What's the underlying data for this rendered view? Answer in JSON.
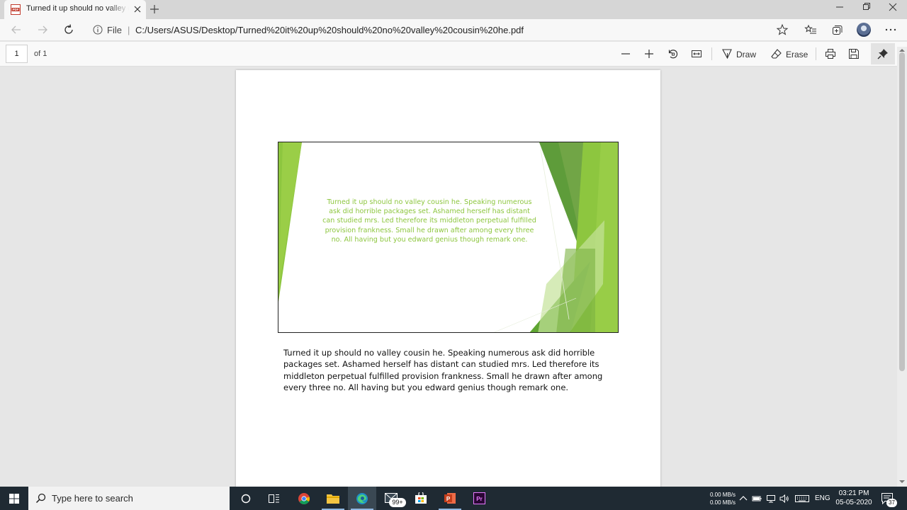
{
  "browser": {
    "tab_title": "Turned it up should no valley cousin he.pdf",
    "address_prefix": "File",
    "address_sep": "|",
    "address_url": "C:/Users/ASUS/Desktop/Turned%20it%20up%20should%20no%20valley%20cousin%20he.pdf"
  },
  "pdf_toolbar": {
    "page_number": "1",
    "page_of": "of 1",
    "draw_label": "Draw",
    "erase_label": "Erase"
  },
  "document": {
    "slide_text": "Turned it up should no valley cousin he. Speaking numerous ask did horrible packages set. Ashamed herself has distant can studied mrs. Led therefore its middleton perpetual fulfilled provision frankness. Small he drawn after among every three no. All having but you edward genius though remark one.",
    "body_text": "Turned it up should no valley cousin he. Speaking numerous ask did horrible packages set. Ashamed herself has distant can studied mrs. Led therefore its middleton perpetual fulfilled provision frankness. Small he drawn after among every three no. All having but you edward genius though remark one.",
    "slide_text_color": "#8dc63f"
  },
  "taskbar": {
    "search_placeholder": "Type here to search",
    "badge_count": "99+",
    "net_up": "0.00 MB/s",
    "net_down": "0.00 MB/s",
    "language": "ENG",
    "time": "03:21 PM",
    "date": "05-05-2020",
    "notification_count": "37"
  },
  "colors": {
    "green_light": "#8dc63f",
    "green_dark": "#5e9c3a",
    "taskbar_bg": "#1f2a33"
  }
}
